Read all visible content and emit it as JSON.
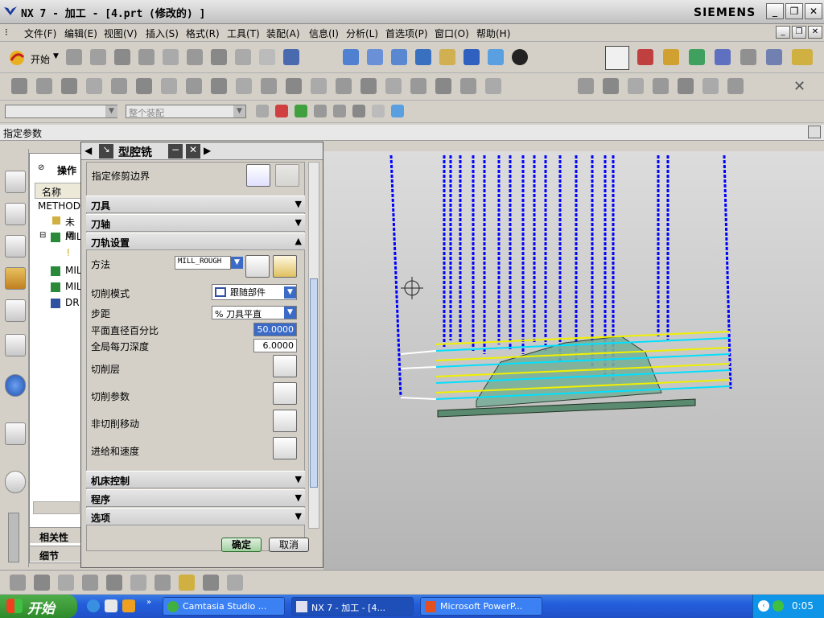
{
  "titlebar": {
    "title": "NX 7 - 加工 - [4.prt  (修改的)  ]",
    "brand": "SIEMENS"
  },
  "menubar": {
    "items": [
      "文件(F)",
      "编辑(E)",
      "视图(V)",
      "插入(S)",
      "格式(R)",
      "工具(T)",
      "装配(A)",
      "信息(I)",
      "分析(L)",
      "首选项(P)",
      "窗口(O)",
      "帮助(H)"
    ]
  },
  "toolbar": {
    "start_label": "开始",
    "filter_value": "整个装配"
  },
  "cmdbar": {
    "prompt": "指定参数"
  },
  "navigator": {
    "header": "操作",
    "column_name": "名称",
    "rows": [
      "METHOD",
      "未用",
      "MIL",
      "MIL",
      "MIL",
      "DR"
    ],
    "bottom_tabs": [
      "相关性",
      "细节"
    ]
  },
  "dialog": {
    "title": "型腔铣",
    "trim_boundary_label": "指定修剪边界",
    "sections": {
      "tool": "刀具",
      "axis": "刀轴",
      "path_settings": "刀轨设置",
      "machine_control": "机床控制",
      "program": "程序",
      "options": "选项"
    },
    "params": {
      "method_label": "方法",
      "method_value": "MILL_ROUGH",
      "cut_pattern_label": "切削模式",
      "cut_pattern_value": "跟随部件",
      "stepover_label": "步距",
      "stepover_value": "% 刀具平直",
      "percent_label": "平面直径百分比",
      "percent_value": "50.0000",
      "depth_label": "全局每刀深度",
      "depth_value": "6.0000",
      "levels_label": "切削层",
      "cut_params_label": "切削参数",
      "noncut_label": "非切削移动",
      "feeds_label": "进给和速度"
    },
    "ok": "确定",
    "cancel": "取消"
  },
  "taskbar": {
    "start": "开始",
    "tasks": [
      "Camtasia Studio ...",
      "NX 7 - 加工 - [4...",
      "Microsoft PowerP..."
    ],
    "clock": "0:05"
  },
  "colors": {
    "toolpath_blue": "#0000ff",
    "toolpath_cyan": "#00e0ff",
    "toolpath_yellow": "#f0f000",
    "part_green": "#7ab09a"
  }
}
